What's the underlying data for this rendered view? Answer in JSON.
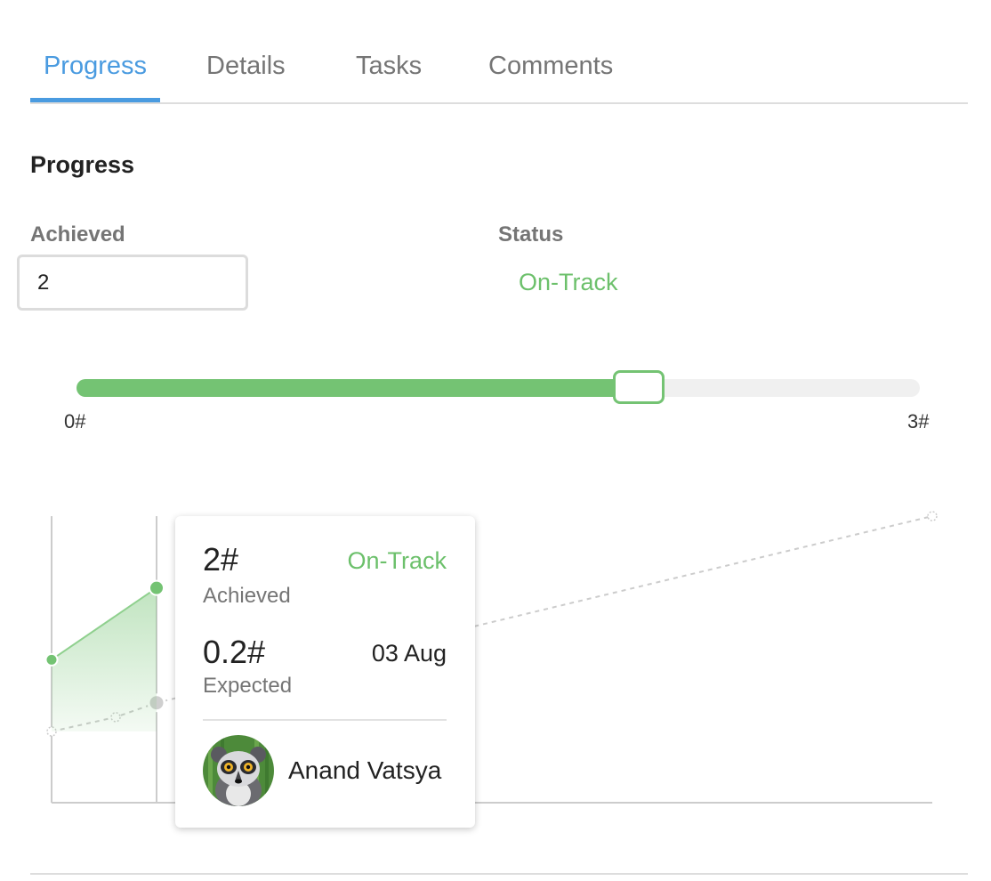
{
  "tabs": [
    {
      "label": "Progress",
      "active": true
    },
    {
      "label": "Details",
      "active": false
    },
    {
      "label": "Tasks",
      "active": false
    },
    {
      "label": "Comments",
      "active": false
    }
  ],
  "progress": {
    "title": "Progress",
    "achieved_label": "Achieved",
    "achieved_value": "2",
    "status_label": "Status",
    "status_value": "On-Track"
  },
  "slider": {
    "min_label": "0#",
    "max_label": "3#",
    "min": 0,
    "max": 3,
    "value": 2
  },
  "tooltip": {
    "achieved_value": "2#",
    "achieved_label": "Achieved",
    "status": "On-Track",
    "expected_value": "0.2#",
    "expected_label": "Expected",
    "date": "03 Aug",
    "user_name": "Anand Vatsya"
  },
  "colors": {
    "accent_blue": "#4a9be0",
    "on_track_green": "#6cc06b",
    "slider_fill": "#74c373",
    "expected_line": "#cccccc"
  },
  "chart_data": {
    "type": "area",
    "series": [
      {
        "values": [
          1,
          2
        ]
      },
      {
        "values": [
          0,
          0.2,
          0.4,
          3
        ]
      }
    ],
    "ylim": [
      0,
      3
    ]
  }
}
